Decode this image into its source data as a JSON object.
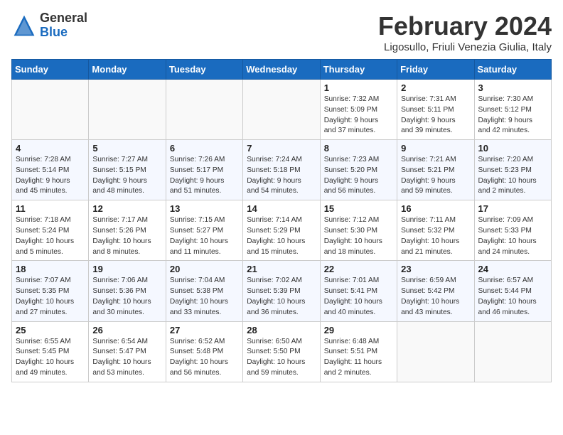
{
  "logo": {
    "general": "General",
    "blue": "Blue"
  },
  "header": {
    "month": "February 2024",
    "location": "Ligosullo, Friuli Venezia Giulia, Italy"
  },
  "weekdays": [
    "Sunday",
    "Monday",
    "Tuesday",
    "Wednesday",
    "Thursday",
    "Friday",
    "Saturday"
  ],
  "weeks": [
    [
      {
        "day": "",
        "info": ""
      },
      {
        "day": "",
        "info": ""
      },
      {
        "day": "",
        "info": ""
      },
      {
        "day": "",
        "info": ""
      },
      {
        "day": "1",
        "info": "Sunrise: 7:32 AM\nSunset: 5:09 PM\nDaylight: 9 hours\nand 37 minutes."
      },
      {
        "day": "2",
        "info": "Sunrise: 7:31 AM\nSunset: 5:11 PM\nDaylight: 9 hours\nand 39 minutes."
      },
      {
        "day": "3",
        "info": "Sunrise: 7:30 AM\nSunset: 5:12 PM\nDaylight: 9 hours\nand 42 minutes."
      }
    ],
    [
      {
        "day": "4",
        "info": "Sunrise: 7:28 AM\nSunset: 5:14 PM\nDaylight: 9 hours\nand 45 minutes."
      },
      {
        "day": "5",
        "info": "Sunrise: 7:27 AM\nSunset: 5:15 PM\nDaylight: 9 hours\nand 48 minutes."
      },
      {
        "day": "6",
        "info": "Sunrise: 7:26 AM\nSunset: 5:17 PM\nDaylight: 9 hours\nand 51 minutes."
      },
      {
        "day": "7",
        "info": "Sunrise: 7:24 AM\nSunset: 5:18 PM\nDaylight: 9 hours\nand 54 minutes."
      },
      {
        "day": "8",
        "info": "Sunrise: 7:23 AM\nSunset: 5:20 PM\nDaylight: 9 hours\nand 56 minutes."
      },
      {
        "day": "9",
        "info": "Sunrise: 7:21 AM\nSunset: 5:21 PM\nDaylight: 9 hours\nand 59 minutes."
      },
      {
        "day": "10",
        "info": "Sunrise: 7:20 AM\nSunset: 5:23 PM\nDaylight: 10 hours\nand 2 minutes."
      }
    ],
    [
      {
        "day": "11",
        "info": "Sunrise: 7:18 AM\nSunset: 5:24 PM\nDaylight: 10 hours\nand 5 minutes."
      },
      {
        "day": "12",
        "info": "Sunrise: 7:17 AM\nSunset: 5:26 PM\nDaylight: 10 hours\nand 8 minutes."
      },
      {
        "day": "13",
        "info": "Sunrise: 7:15 AM\nSunset: 5:27 PM\nDaylight: 10 hours\nand 11 minutes."
      },
      {
        "day": "14",
        "info": "Sunrise: 7:14 AM\nSunset: 5:29 PM\nDaylight: 10 hours\nand 15 minutes."
      },
      {
        "day": "15",
        "info": "Sunrise: 7:12 AM\nSunset: 5:30 PM\nDaylight: 10 hours\nand 18 minutes."
      },
      {
        "day": "16",
        "info": "Sunrise: 7:11 AM\nSunset: 5:32 PM\nDaylight: 10 hours\nand 21 minutes."
      },
      {
        "day": "17",
        "info": "Sunrise: 7:09 AM\nSunset: 5:33 PM\nDaylight: 10 hours\nand 24 minutes."
      }
    ],
    [
      {
        "day": "18",
        "info": "Sunrise: 7:07 AM\nSunset: 5:35 PM\nDaylight: 10 hours\nand 27 minutes."
      },
      {
        "day": "19",
        "info": "Sunrise: 7:06 AM\nSunset: 5:36 PM\nDaylight: 10 hours\nand 30 minutes."
      },
      {
        "day": "20",
        "info": "Sunrise: 7:04 AM\nSunset: 5:38 PM\nDaylight: 10 hours\nand 33 minutes."
      },
      {
        "day": "21",
        "info": "Sunrise: 7:02 AM\nSunset: 5:39 PM\nDaylight: 10 hours\nand 36 minutes."
      },
      {
        "day": "22",
        "info": "Sunrise: 7:01 AM\nSunset: 5:41 PM\nDaylight: 10 hours\nand 40 minutes."
      },
      {
        "day": "23",
        "info": "Sunrise: 6:59 AM\nSunset: 5:42 PM\nDaylight: 10 hours\nand 43 minutes."
      },
      {
        "day": "24",
        "info": "Sunrise: 6:57 AM\nSunset: 5:44 PM\nDaylight: 10 hours\nand 46 minutes."
      }
    ],
    [
      {
        "day": "25",
        "info": "Sunrise: 6:55 AM\nSunset: 5:45 PM\nDaylight: 10 hours\nand 49 minutes."
      },
      {
        "day": "26",
        "info": "Sunrise: 6:54 AM\nSunset: 5:47 PM\nDaylight: 10 hours\nand 53 minutes."
      },
      {
        "day": "27",
        "info": "Sunrise: 6:52 AM\nSunset: 5:48 PM\nDaylight: 10 hours\nand 56 minutes."
      },
      {
        "day": "28",
        "info": "Sunrise: 6:50 AM\nSunset: 5:50 PM\nDaylight: 10 hours\nand 59 minutes."
      },
      {
        "day": "29",
        "info": "Sunrise: 6:48 AM\nSunset: 5:51 PM\nDaylight: 11 hours\nand 2 minutes."
      },
      {
        "day": "",
        "info": ""
      },
      {
        "day": "",
        "info": ""
      }
    ]
  ]
}
